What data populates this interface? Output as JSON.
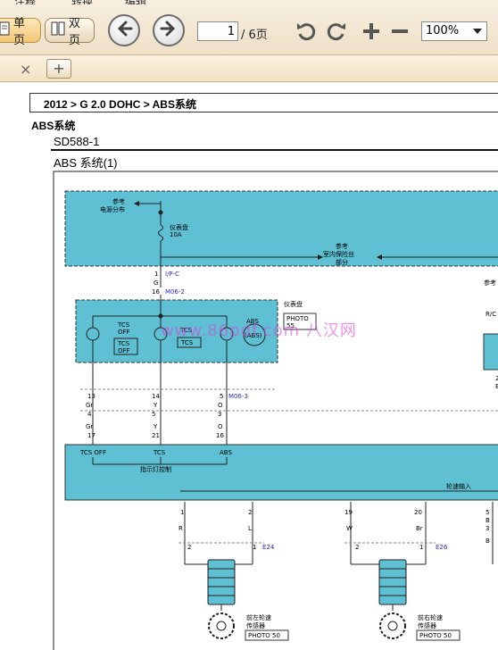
{
  "toolbar": {
    "top_menu": [
      "注释",
      "转换",
      "编辑"
    ],
    "single_page_label": "单页",
    "double_page_label": "双页",
    "current_page": "1",
    "total_pages": "/ 6页",
    "zoom": "100%"
  },
  "tabs": {
    "close_label": "×",
    "add_label": "+"
  },
  "document": {
    "breadcrumb": "2012 > G 2.0 DOHC > ABS系统",
    "section_title": "ABS系统",
    "doc_code": "SD588-1",
    "diagram_title": "ABS 系统(1)"
  },
  "schematic": {
    "power_ref": [
      "参考",
      "电源分布"
    ],
    "fuse_label": [
      "仪表盘",
      "10A"
    ],
    "fuse_ref": [
      "参考",
      "室内保险丝",
      "部分"
    ],
    "right_ref": "参考",
    "connector_ipc_pin": "1",
    "connector_ipc": "I/P-C",
    "wire_g": "G",
    "pin_16": "16",
    "connector_m062": "M06-2",
    "cluster_label": "仪表盘",
    "photo_55": [
      "PHOTO",
      "55"
    ],
    "lamps": [
      {
        "name": [
          "TCS",
          "OFF"
        ],
        "box": [
          "TCS",
          "OFF"
        ]
      },
      {
        "name": [
          "TCS"
        ],
        "box": [
          "TCS"
        ]
      },
      {
        "name": [
          "ABS"
        ],
        "box": [
          "(ABS)"
        ]
      }
    ],
    "rc_label": "R/C",
    "connector_m063": "M06-3",
    "wire_rows": {
      "pins_top": [
        "13",
        "14",
        "5"
      ],
      "colors_top": [
        "Gr",
        "Y",
        "O"
      ],
      "pins_mid": [
        "4",
        "5",
        "3"
      ],
      "colors_mid": [
        "Gr",
        "Y",
        "O"
      ],
      "pins_bot": [
        "17",
        "21",
        "16"
      ]
    },
    "module_labels": [
      "TCS OFF",
      "TCS",
      "ABS"
    ],
    "module_caption": "指示灯控制",
    "wheel_input": "轮速输入",
    "sensor_left": {
      "pins": [
        "1",
        "2"
      ],
      "colors": [
        "R",
        "L"
      ],
      "pins_bot": [
        "2",
        "1"
      ],
      "connector": "E24",
      "label": [
        "前左轮速",
        "传感器"
      ],
      "photo": "PHOTO 50"
    },
    "sensor_right": {
      "pins": [
        "19",
        "20"
      ],
      "colors": [
        "W",
        "Br"
      ],
      "pins_bot": [
        "2",
        "1"
      ],
      "connector": "E26",
      "label": [
        "前右轮速",
        "传感器"
      ],
      "photo": "PHOTO 50"
    },
    "far_right_pins": [
      "5",
      "B",
      "3",
      "B"
    ],
    "watermark": "www.86pdf.com 八汉网"
  },
  "colors": {
    "module_fill": "#5ec0d2",
    "wire_blue": "#2a2acc",
    "toolbar_bg": "#efe0c6"
  }
}
